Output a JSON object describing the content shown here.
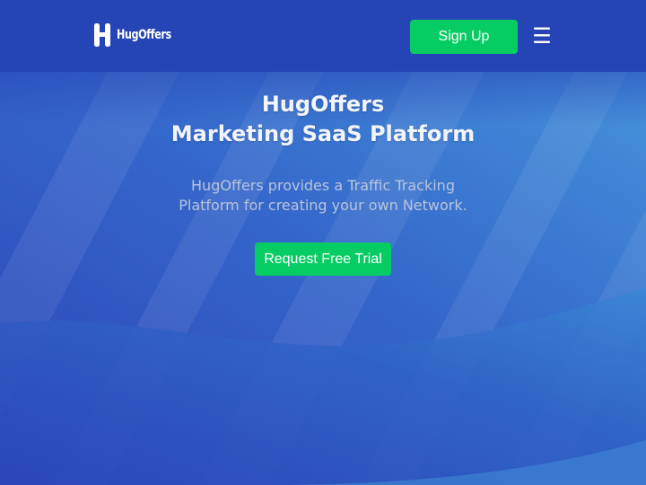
{
  "header": {
    "logo_text": "HugOffers",
    "signup_label": "Sign Up",
    "menu_icon": "☰"
  },
  "hero": {
    "title_line1": "HugOffers",
    "title_line2": "Marketing SaaS Platform",
    "desc_line1": "HugOffers provides a Traffic Tracking",
    "desc_line2": "Platform for creating your own Network.",
    "cta_label": "Request Free Trial"
  },
  "colors": {
    "header_bg": "#2545b6",
    "accent_green": "#06cd63",
    "hero_gradient_start": "#2d4bbb",
    "hero_gradient_end": "#4290d8"
  },
  "icons": {
    "logo": "h-logo-icon",
    "menu": "hamburger-menu-icon"
  }
}
